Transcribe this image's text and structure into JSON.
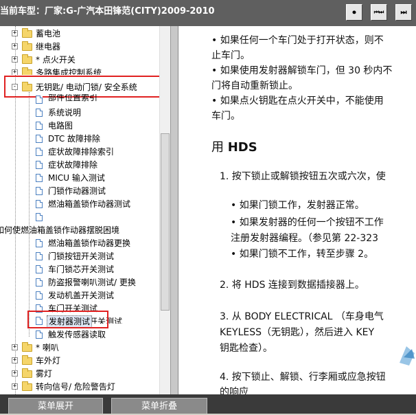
{
  "window": {
    "title": "当前车型：厂家:G-广汽本田锋范(CITY)2009-2010"
  },
  "toolbar": {
    "btn1": "⏺",
    "btn2": "⏮⏭",
    "btn3": "⏭"
  },
  "tree": {
    "items": [
      {
        "label": "蓄电池",
        "type": "folder",
        "expander": "+"
      },
      {
        "label": "继电器",
        "type": "folder",
        "expander": "+"
      },
      {
        "label": "* 点火开关",
        "type": "folder",
        "expander": "+"
      },
      {
        "label": "多路集成控制系统",
        "type": "folder",
        "expander": "+"
      },
      {
        "label": "无钥匙/ 电动门锁/ 安全系统",
        "type": "folder",
        "expander": "-"
      },
      {
        "label": "部件位置索引",
        "type": "page"
      },
      {
        "label": "系统说明",
        "type": "page"
      },
      {
        "label": "电路图",
        "type": "page"
      },
      {
        "label": "DTC 故障排除",
        "type": "page"
      },
      {
        "label": "症状故障排除索引",
        "type": "page"
      },
      {
        "label": "症状故障排除",
        "type": "page"
      },
      {
        "label": "MICU 输入测试",
        "type": "page"
      },
      {
        "label": "门锁作动器测试",
        "type": "page"
      },
      {
        "label": "燃油箱盖锁作动器测试",
        "type": "page"
      },
      {
        "label": "",
        "type": "page"
      },
      {
        "label": "如何使燃油箱盖锁作动器摆脱困境",
        "type": "text"
      },
      {
        "label": "燃油箱盖锁作动器更换",
        "type": "page"
      },
      {
        "label": "门锁按钮开关测试",
        "type": "page"
      },
      {
        "label": "车门锁芯开关测试",
        "type": "page"
      },
      {
        "label": "防盗报警喇叭测试/ 更换",
        "type": "page"
      },
      {
        "label": "发动机盖开关测试",
        "type": "page"
      },
      {
        "label": "车门开关测试",
        "type": "page"
      },
      {
        "label": "行李厢锁芯开关测试",
        "type": "page"
      },
      {
        "label": "发射器测试",
        "type": "page"
      },
      {
        "label": "触发传感器读取",
        "type": "page"
      },
      {
        "label": "* 喇叭",
        "type": "folder",
        "expander": "+"
      },
      {
        "label": "车外灯",
        "type": "folder",
        "expander": "+"
      },
      {
        "label": "雾灯",
        "type": "folder",
        "expander": "+"
      },
      {
        "label": "转向信号/ 危险警告灯",
        "type": "folder",
        "expander": "+"
      }
    ]
  },
  "doc": {
    "bullets_top": [
      "• 如果任何一个车门处于打开状态，则不",
      "  止车门。",
      "• 如果使用发射器解锁车门，但 30 秒内不",
      "  门将自动重新锁止。",
      "• 如果点火钥匙在点火开关中，不能使用",
      "  车门。"
    ],
    "heading_prefix": "用 ",
    "heading_bold": "HDS",
    "step1": "1. 按下锁止或解锁按钮五次或六次，使",
    "sub_bullets": [
      "• 如果门锁工作，发射器正常。",
      "• 如果发射器的任何一个按钮不工作",
      "  注册发射器编程。（参见第 22-323",
      "• 如果门锁不工作，转至步骤 2。"
    ],
    "step2": "2. 将 HDS 连接到数据插接器上。",
    "step3_lines": [
      "3. 从 BODY ELECTRICAL （车身电气",
      "   KEYLESS（无钥匙），然后进入 KEY",
      "   钥匙检查）。"
    ],
    "step4_lines": [
      "4. 按下锁止、解锁、行李厢或应急按钮",
      "   的响应"
    ]
  },
  "bottom": {
    "expand_label": "菜单展开",
    "collapse_label": "菜单折叠"
  },
  "colors": {
    "highlight": "#e02020",
    "titlebar": "#5f5f5f"
  }
}
